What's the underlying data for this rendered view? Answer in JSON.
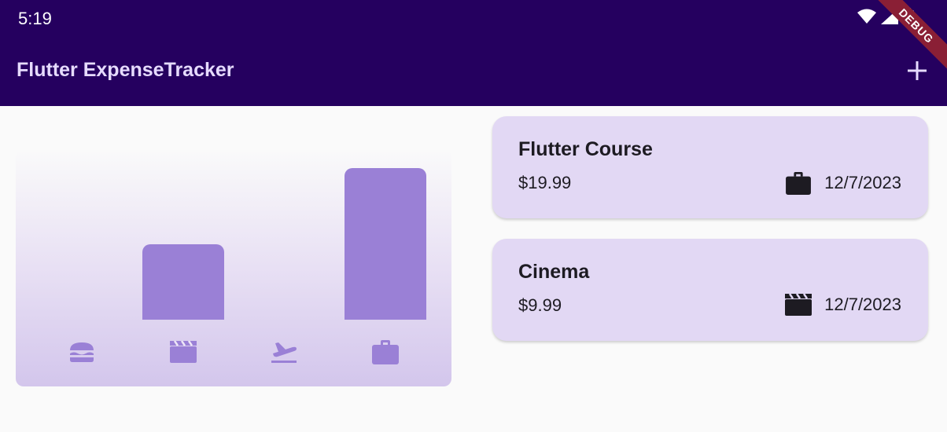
{
  "status_bar": {
    "time": "5:19"
  },
  "app_bar": {
    "title": "Flutter ExpenseTracker",
    "add_icon": "add-icon"
  },
  "debug_banner": "DEBUG",
  "colors": {
    "app_bar": "#25005f",
    "bar": "#9a80d6",
    "card": "#e2d8f4"
  },
  "chart_data": {
    "type": "bar",
    "categories": [
      "food-icon",
      "leisure-icon",
      "travel-icon",
      "work-icon"
    ],
    "values": [
      0,
      9.99,
      0,
      19.99
    ],
    "ylim": [
      0,
      19.99
    ]
  },
  "expenses": [
    {
      "title": "Flutter Course",
      "amount": "$19.99",
      "category_icon": "work-icon",
      "date": "12/7/2023"
    },
    {
      "title": "Cinema",
      "amount": "$9.99",
      "category_icon": "movie-icon",
      "date": "12/7/2023"
    }
  ]
}
